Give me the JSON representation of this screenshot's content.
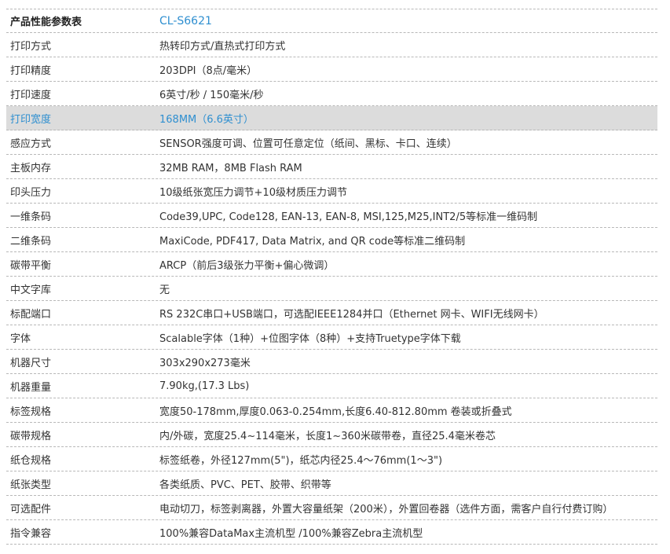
{
  "header": {
    "label": "产品性能参数表",
    "model": "CL-S6621"
  },
  "rows": [
    {
      "label": "打印方式",
      "value": "热转印方式/直热式打印方式"
    },
    {
      "label": "打印精度",
      "value": "203DPI（8点/毫米）"
    },
    {
      "label": "打印速度",
      "value": "6英寸/秒   /   150毫米/秒"
    },
    {
      "label": "打印宽度",
      "value": "168MM（6.6英寸）"
    },
    {
      "label": "感应方式",
      "value": "SENSOR强度可调、位置可任意定位（纸间、黑标、卡口、连续）"
    },
    {
      "label": "主板内存",
      "value": "32MB RAM，8MB Flash RAM"
    },
    {
      "label": "印头压力",
      "value": "10级纸张宽压力调节+10级材质压力调节"
    },
    {
      "label": "一维条码",
      "value": "Code39,UPC, Code128, EAN-13, EAN-8, MSI,125,M25,INT2/5等标准一维码制"
    },
    {
      "label": "二维条码",
      "value": "MaxiCode, PDF417, Data Matrix, and QR code等标准二维码制"
    },
    {
      "label": "碳带平衡",
      "value": "ARCP（前后3级张力平衡+偏心微调）"
    },
    {
      "label": "中文字库",
      "value": "无"
    },
    {
      "label": "标配端口",
      "value": "RS 232C串口+USB端口，可选配IEEE1284并口（Ethernet 网卡、WIFI无线网卡）"
    },
    {
      "label": "字体",
      "value": "Scalable字体（1种）+位图字体（8种）+支持Truetype字体下载"
    },
    {
      "label": "机器尺寸",
      "value": "303x290x273毫米"
    },
    {
      "label": "机器重量",
      "value": "7.90kg,(17.3 Lbs)"
    },
    {
      "label": "标签规格",
      "value": "宽度50-178mm,厚度0.063-0.254mm,长度6.40-812.80mm 卷装或折叠式"
    },
    {
      "label": "碳带规格",
      "value": "内/外碳，宽度25.4~114毫米，长度1~360米碳带卷，直径25.4毫米卷芯"
    },
    {
      "label": "纸仓规格",
      "value": "标签纸卷，外径127mm(5\")，纸芯内径25.4～76mm(1～3\")"
    },
    {
      "label": "纸张类型",
      "value": "各类纸质、PVC、PET、胶带、织带等"
    },
    {
      "label": "可选配件",
      "value": "电动切刀，标签剥离器，外置大容量纸架（200米），外置回卷器（选件方面，需客户自行付费订购）"
    },
    {
      "label": "指令兼容",
      "value": "100%兼容DataMax主流机型 /100%兼容Zebra主流机型"
    }
  ]
}
